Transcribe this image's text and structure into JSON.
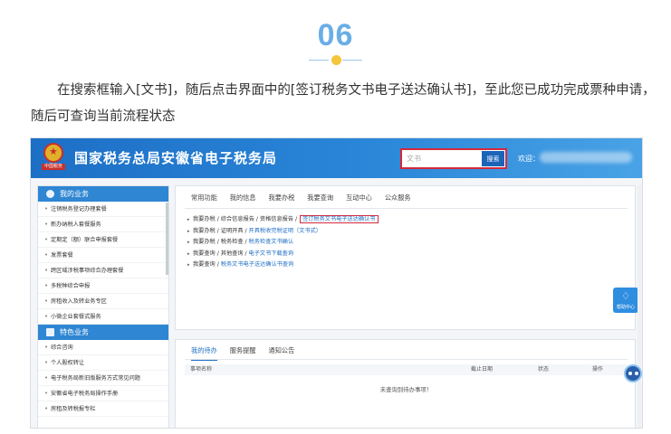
{
  "article": {
    "step": "06",
    "intro": "在搜索框输入[文书]，随后点击界面中的[签订税务文书电子送达确认书]，至此您已成功完成票种申请，随后可查询当前流程状态"
  },
  "portal": {
    "emblem_text": "中国税务",
    "title": "国家税务总局安徽省电子税务局",
    "search": {
      "value": "文书",
      "button": "搜索"
    },
    "welcome": "欢迎："
  },
  "sidebar": {
    "section1": "我的业务",
    "items1": [
      "注销税务登记办理套餐",
      "新办纳税人套餐服务",
      "定期定（额）联合申报套餐",
      "发票套餐",
      "跨区域涉税事项综合办理套餐",
      "多税种综合申报",
      "房租收入及转业务专区",
      "小微企业套餐式服务"
    ],
    "section2": "特色业务",
    "items2": [
      "综合咨询",
      "个人股权转让",
      "电子税务局新旧版服务方式常见问题",
      "安徽省电子税务局操作手册",
      "房租及转税报专栏"
    ]
  },
  "main": {
    "tabs": [
      "常用功能",
      "我的信息",
      "我要办税",
      "我要查询",
      "互动中心",
      "公众服务"
    ],
    "paths": [
      {
        "pre": "我要办税 / 综合信息报告 / 资格信息报告 / ",
        "link": "签订税务文书电子送达确认书",
        "highlight": true
      },
      {
        "pre": "我要办税 / 证明开具 / ",
        "link": "开具税收完税证明（文书式）",
        "highlight": false
      },
      {
        "pre": "我要办税 / 税务检查 / ",
        "link": "税务检查文书确认",
        "highlight": false
      },
      {
        "pre": "我要查询 / 其他查询 / ",
        "link": "电子文书下载查询",
        "highlight": false
      },
      {
        "pre": "我要查询 / ",
        "link": "税务文书电子送达确认书查询",
        "highlight": false
      }
    ],
    "help": "帮助中心"
  },
  "todo": {
    "tabs": [
      "我的待办",
      "服务提醒",
      "通知公告"
    ],
    "columns": [
      "事项名称",
      "截止日期",
      "状态",
      "操作"
    ],
    "empty": "未查询到待办事项！"
  },
  "colors": {
    "accent": "#2f86d3",
    "highlight": "#d6283a",
    "step": "#6aaee6",
    "dot": "#f5c53a"
  }
}
